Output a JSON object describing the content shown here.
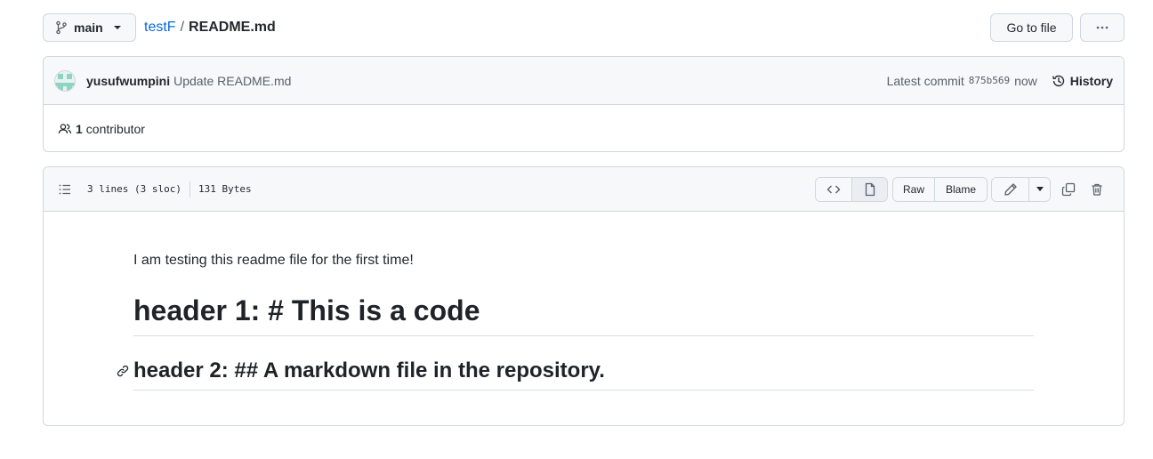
{
  "topbar": {
    "branch": "main",
    "repo": "testF",
    "separator": "/",
    "file": "README.md",
    "goto_label": "Go to file",
    "more_label": "···"
  },
  "commit": {
    "author": "yusufwumpini",
    "message": "Update README.md",
    "latest_label": "Latest commit",
    "sha": "875b569",
    "time": "now",
    "history_label": "History"
  },
  "contributors": {
    "count": "1",
    "label": "contributor"
  },
  "file_header": {
    "lines": "3 lines (3 sloc)",
    "size": "131 Bytes",
    "raw_label": "Raw",
    "blame_label": "Blame"
  },
  "readme": {
    "paragraph": "I am testing this readme file for the first time!",
    "h1": "header 1: # This is a code",
    "h2": "header 2: ## A markdown file in the repository."
  },
  "colors": {
    "link": "#0969da",
    "border": "#d0d7de",
    "header_bg": "#f6f8fa",
    "text": "#1f2328"
  }
}
